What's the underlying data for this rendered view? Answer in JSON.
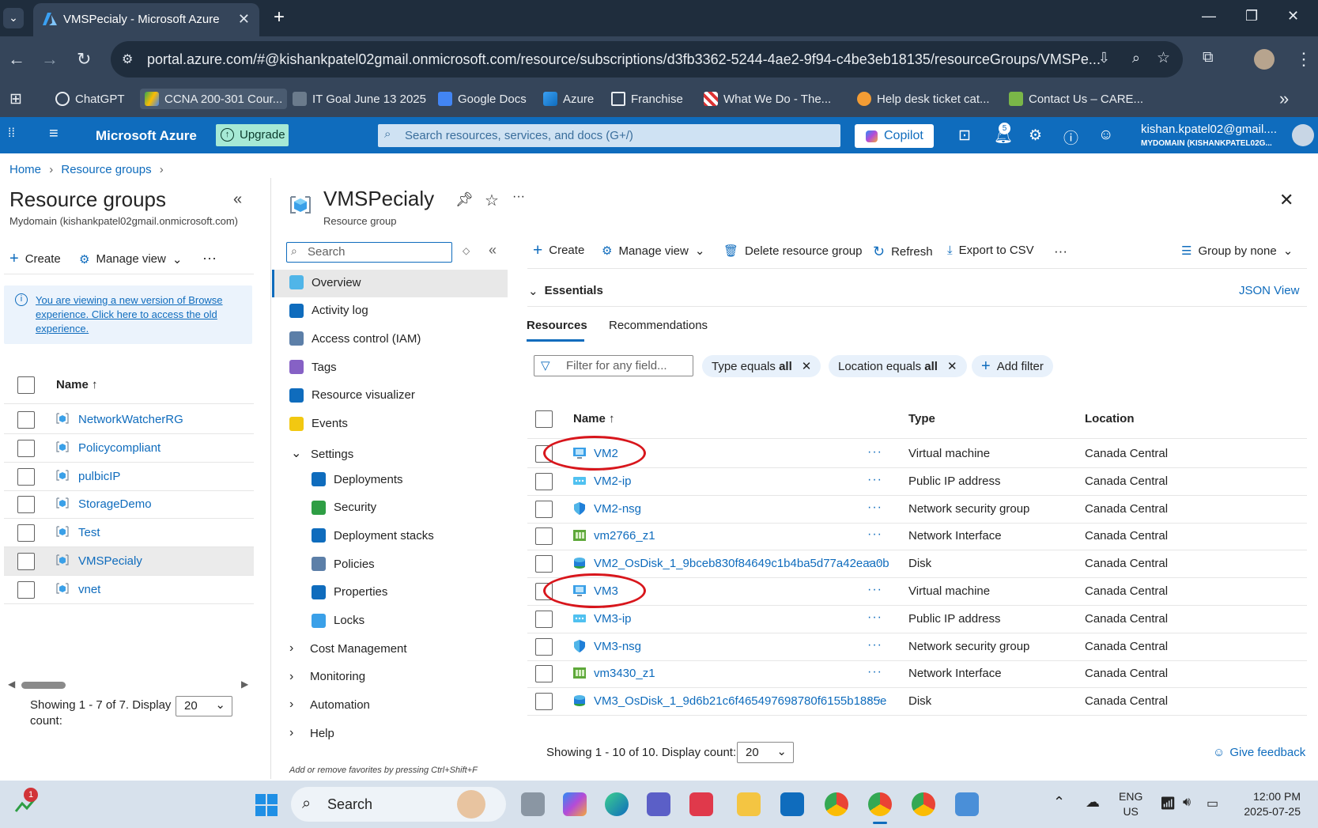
{
  "browser": {
    "tab_title": "VMSPecialy - Microsoft Azure",
    "new_tab": "+",
    "url": "portal.azure.com/#@kishankpatel02gmail.onmicrosoft.com/resource/subscriptions/d3fb3362-5244-4ae2-9f94-c4be3eb18135/resourceGroups/VMSPe...",
    "bookmarks": [
      "ChatGPT",
      "CCNA 200-301 Cour...",
      "IT Goal June 13 2025",
      "Google Docs",
      "Azure",
      "Franchise",
      "What We Do - The...",
      "Help desk ticket cat...",
      "Contact Us – CARE..."
    ],
    "more_bookmarks": "»"
  },
  "azure": {
    "brand": "Microsoft Azure",
    "upgrade": "Upgrade",
    "search_placeholder": "Search resources, services, and docs (G+/)",
    "copilot": "Copilot",
    "notification_count": "5",
    "user_email": "kishan.kpatel02@gmail....",
    "user_directory": "MYDOMAIN (KISHANKPATEL02G..."
  },
  "breadcrumb": [
    "Home",
    "Resource groups"
  ],
  "left_blade": {
    "title": "Resource groups",
    "subtitle": "Mydomain (kishankpatel02gmail.onmicrosoft.com)",
    "create": "Create",
    "manage_view": "Manage view",
    "info_text": "You are viewing a new version of Browse experience. Click here to access the old experience.",
    "col_name": "Name ↑",
    "items": [
      "NetworkWatcherRG",
      "Policycompliant",
      "pulbicIP",
      "StorageDemo",
      "Test",
      "VMSPecialy",
      "vnet"
    ],
    "selected_index": 5,
    "showing": "Showing 1 - 7 of 7. Display count:",
    "count_value": "20"
  },
  "resource": {
    "title": "VMSPecialy",
    "subtitle": "Resource group",
    "search_placeholder": "Search",
    "menu": [
      {
        "label": "Overview",
        "color": "#50b5e8"
      },
      {
        "label": "Activity log",
        "color": "#0f6cbd"
      },
      {
        "label": "Access control (IAM)",
        "color": "#5c7fa8"
      },
      {
        "label": "Tags",
        "color": "#8661c5"
      },
      {
        "label": "Resource visualizer",
        "color": "#0f6cbd"
      },
      {
        "label": "Events",
        "color": "#f2c811"
      }
    ],
    "settings_label": "Settings",
    "settings_items": [
      {
        "label": "Deployments",
        "color": "#0f6cbd"
      },
      {
        "label": "Security",
        "color": "#2e9e44"
      },
      {
        "label": "Deployment stacks",
        "color": "#0f6cbd"
      },
      {
        "label": "Policies",
        "color": "#5c7fa8"
      },
      {
        "label": "Properties",
        "color": "#0f6cbd"
      },
      {
        "label": "Locks",
        "color": "#3aa0e8"
      }
    ],
    "collapsed_groups": [
      "Cost Management",
      "Monitoring",
      "Automation",
      "Help"
    ],
    "favorites_hint": "Add or remove favorites by pressing Ctrl+Shift+F"
  },
  "toolbar": {
    "create": "Create",
    "manage_view": "Manage view",
    "delete": "Delete resource group",
    "refresh": "Refresh",
    "export": "Export to CSV",
    "group_by": "Group by none"
  },
  "essentials": {
    "label": "Essentials",
    "json_view": "JSON View"
  },
  "tabs": [
    "Resources",
    "Recommendations"
  ],
  "filters": {
    "placeholder": "Filter for any field...",
    "type_prefix": "Type equals",
    "type_value": "all",
    "location_prefix": "Location equals",
    "location_value": "all",
    "add_filter": "Add filter"
  },
  "table": {
    "headers": {
      "name": "Name ↑",
      "type": "Type",
      "location": "Location"
    },
    "rows": [
      {
        "name": "VM2",
        "type": "Virtual machine",
        "location": "Canada Central",
        "icon": "vm-icon",
        "circled": true
      },
      {
        "name": "VM2-ip",
        "type": "Public IP address",
        "location": "Canada Central",
        "icon": "public-ip-icon"
      },
      {
        "name": "VM2-nsg",
        "type": "Network security group",
        "location": "Canada Central",
        "icon": "nsg-icon"
      },
      {
        "name": "vm2766_z1",
        "type": "Network Interface",
        "location": "Canada Central",
        "icon": "nic-icon"
      },
      {
        "name": "VM2_OsDisk_1_9bceb830f84649c1b4ba5d77a42eaa0b",
        "type": "Disk",
        "location": "Canada Central",
        "icon": "disk-icon"
      },
      {
        "name": "VM3",
        "type": "Virtual machine",
        "location": "Canada Central",
        "icon": "vm-icon",
        "circled": true
      },
      {
        "name": "VM3-ip",
        "type": "Public IP address",
        "location": "Canada Central",
        "icon": "public-ip-icon"
      },
      {
        "name": "VM3-nsg",
        "type": "Network security group",
        "location": "Canada Central",
        "icon": "nsg-icon"
      },
      {
        "name": "vm3430_z1",
        "type": "Network Interface",
        "location": "Canada Central",
        "icon": "nic-icon"
      },
      {
        "name": "VM3_OsDisk_1_9d6b21c6f465497698780f6155b1885e",
        "type": "Disk",
        "location": "Canada Central",
        "icon": "disk-icon"
      }
    ],
    "showing": "Showing 1 - 10 of 10. Display count:",
    "count_value": "20",
    "feedback": "Give feedback"
  },
  "taskbar": {
    "search": "Search",
    "lang": "ENG",
    "region": "US",
    "time": "12:00 PM",
    "date": "2025-07-25",
    "badge": "1"
  }
}
